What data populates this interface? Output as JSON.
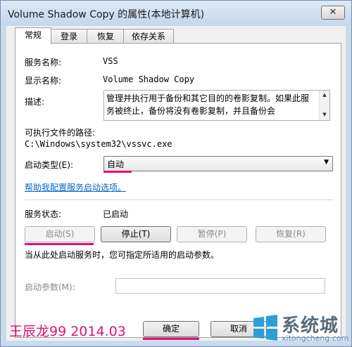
{
  "window": {
    "title": "Volume Shadow Copy 的属性(本地计算机)",
    "close_glyph": "✕"
  },
  "tabs": [
    {
      "label": "常规"
    },
    {
      "label": "登录"
    },
    {
      "label": "恢复"
    },
    {
      "label": "依存关系"
    }
  ],
  "general": {
    "service_name_label": "服务名称:",
    "service_name_value": "VSS",
    "display_name_label": "显示名称:",
    "display_name_value": "Volume Shadow Copy",
    "description_label": "描述:",
    "description_value": "管理并执行用于备份和其它目的的卷影复制。如果此服务被终止，备份将没有卷影复制，并且备份会",
    "path_label": "可执行文件的路径:",
    "path_value": "C:\\Windows\\system32\\vssvc.exe",
    "startup_type_label": "启动类型(E):",
    "startup_type_value": "自动",
    "help_link": "帮助我配置服务启动选项。",
    "status_label": "服务状态:",
    "status_value": "已启动",
    "buttons": {
      "start": "启动(S)",
      "stop": "停止(T)",
      "pause": "暂停(P)",
      "resume": "恢复(R)"
    },
    "hint": "当从此处启动服务时，您可指定所适用的启动参数。",
    "param_label": "启动参数(M):",
    "param_value": ""
  },
  "footer": {
    "ok": "确定",
    "cancel": "取消"
  },
  "watermark": {
    "text": "王辰龙99 2014.03"
  },
  "site_logo": {
    "text": "系统城",
    "url": "xitongcheng.com"
  },
  "colors": {
    "accent_line": "#e0117a",
    "link": "#0066cc"
  }
}
